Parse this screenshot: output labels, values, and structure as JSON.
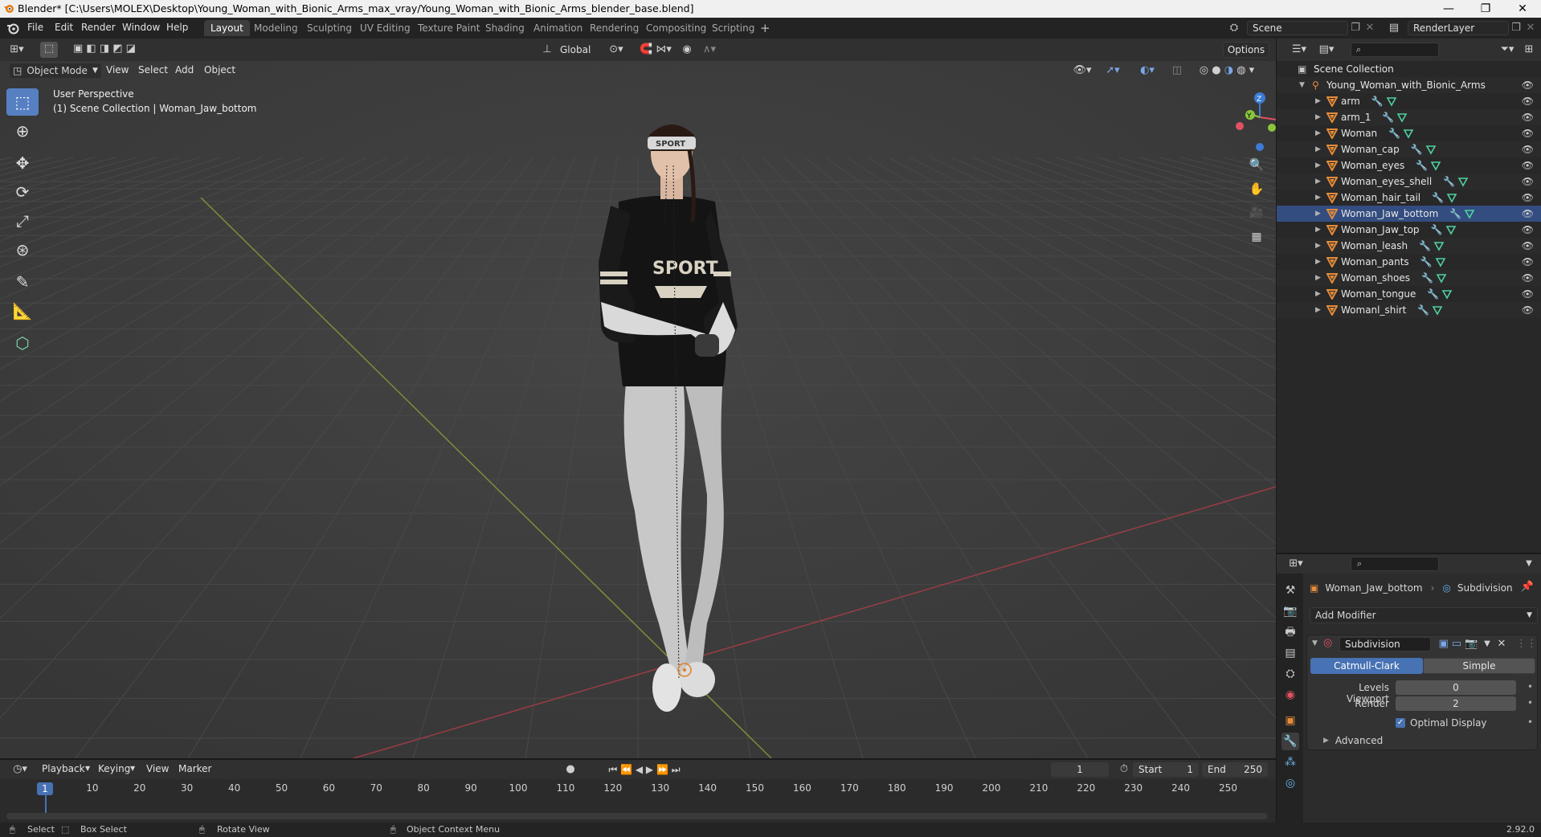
{
  "window": {
    "title": "Blender* [C:\\Users\\MOLEX\\Desktop\\Young_Woman_with_Bionic_Arms_max_vray/Young_Woman_with_Bionic_Arms_blender_base.blend]",
    "minimize": "—",
    "maximize": "❐",
    "close": "✕"
  },
  "menus": [
    "File",
    "Edit",
    "Render",
    "Window",
    "Help"
  ],
  "workspaces": [
    {
      "label": "Layout",
      "active": true
    },
    {
      "label": "Modeling"
    },
    {
      "label": "Sculpting"
    },
    {
      "label": "UV Editing"
    },
    {
      "label": "Texture Paint"
    },
    {
      "label": "Shading"
    },
    {
      "label": "Animation"
    },
    {
      "label": "Rendering"
    },
    {
      "label": "Compositing"
    },
    {
      "label": "Scripting"
    }
  ],
  "add_workspace": "+",
  "scene": {
    "name": "Scene",
    "render_layer": "RenderLayer"
  },
  "viewport": {
    "mode": "Object Mode",
    "menu": [
      "View",
      "Select",
      "Add",
      "Object"
    ],
    "transform_orientation": "Global",
    "options": "Options",
    "info_line1": "User Perspective",
    "info_line2": "(1) Scene Collection | Woman_Jaw_bottom",
    "gizmo": {
      "z": "Z",
      "y": "Y",
      "x": "X"
    }
  },
  "outliner": {
    "root": "Scene Collection",
    "collection": "Young_Woman_with_Bionic_Arms",
    "objects": [
      {
        "name": "arm"
      },
      {
        "name": "arm_1"
      },
      {
        "name": "Woman"
      },
      {
        "name": "Woman_cap"
      },
      {
        "name": "Woman_eyes"
      },
      {
        "name": "Woman_eyes_shell"
      },
      {
        "name": "Woman_hair_tail"
      },
      {
        "name": "Woman_Jaw_bottom",
        "selected": true
      },
      {
        "name": "Woman_Jaw_top"
      },
      {
        "name": "Woman_leash"
      },
      {
        "name": "Woman_pants"
      },
      {
        "name": "Woman_shoes"
      },
      {
        "name": "Woman_tongue"
      },
      {
        "name": "Womanl_shirt"
      }
    ]
  },
  "properties": {
    "object": "Woman_Jaw_bottom",
    "modifier_tab": "Subdivision",
    "add_modifier": "Add Modifier",
    "modifier_name": "Subdivision",
    "method_catmull": "Catmull-Clark",
    "method_simple": "Simple",
    "levels_viewport_label": "Levels Viewport",
    "levels_viewport_value": "0",
    "render_label": "Render",
    "render_value": "2",
    "optimal_display": "Optimal Display",
    "advanced": "Advanced"
  },
  "timeline": {
    "menu": [
      "Playback",
      "Keying",
      "View",
      "Marker"
    ],
    "current_frame": "1",
    "start_label": "Start",
    "start_value": "1",
    "end_label": "End",
    "end_value": "250",
    "playhead": "1",
    "ticks": [
      "10",
      "20",
      "30",
      "40",
      "50",
      "60",
      "70",
      "80",
      "90",
      "100",
      "110",
      "120",
      "130",
      "140",
      "150",
      "160",
      "170",
      "180",
      "190",
      "200",
      "210",
      "220",
      "230",
      "240",
      "250"
    ]
  },
  "statusbar": {
    "select": "Select",
    "box_select": "Box Select",
    "rotate_view": "Rotate View",
    "context_menu": "Object Context Menu",
    "version": "2.92.0"
  },
  "colors": {
    "accent": "#5680c2",
    "selected_row": "#334d80",
    "mesh_icon": "#e58c3a",
    "modifier_icon": "#6ab0e8",
    "data_icon": "#4fd1a0",
    "x_axis": "#e05263",
    "y_axis": "#8ac53b",
    "z_axis": "#3c7bd6"
  }
}
